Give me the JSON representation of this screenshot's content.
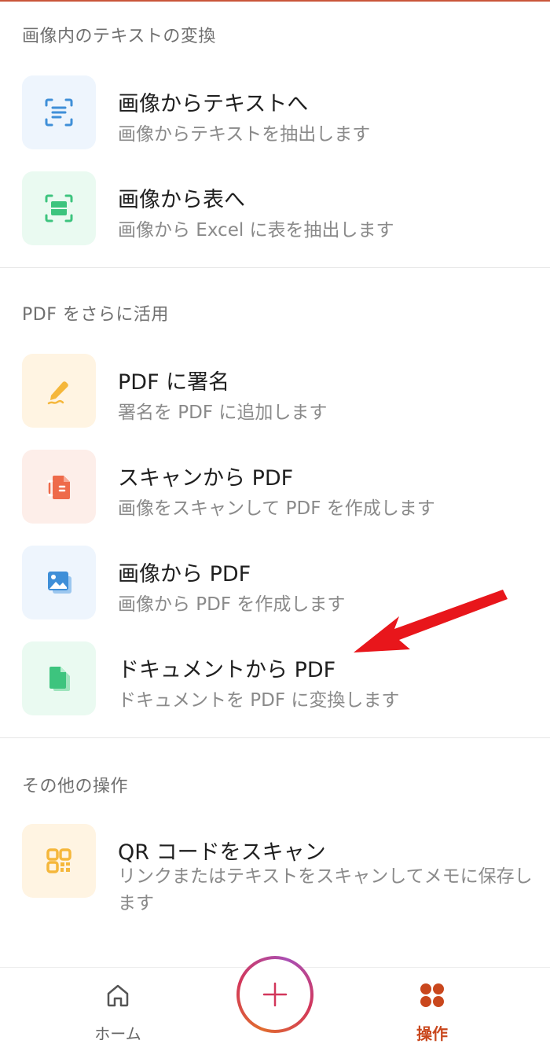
{
  "sections": {
    "image_text": {
      "header": "画像内のテキストの変換",
      "items": [
        {
          "title": "画像からテキストへ",
          "subtitle": "画像からテキストを抽出します",
          "icon": "text-scan-icon"
        },
        {
          "title": "画像から表へ",
          "subtitle": "画像から Excel に表を抽出します",
          "icon": "table-scan-icon"
        }
      ]
    },
    "pdf": {
      "header": "PDF をさらに活用",
      "items": [
        {
          "title": "PDF に署名",
          "subtitle": "署名を PDF に追加します",
          "icon": "pen-sign-icon"
        },
        {
          "title": "スキャンから PDF",
          "subtitle": "画像をスキャンして PDF を作成します",
          "icon": "scan-document-icon"
        },
        {
          "title": "画像から PDF",
          "subtitle": "画像から PDF を作成します",
          "icon": "image-icon"
        },
        {
          "title": "ドキュメントから PDF",
          "subtitle": "ドキュメントを PDF に変換します",
          "icon": "document-icon"
        }
      ]
    },
    "other": {
      "header": "その他の操作",
      "items": [
        {
          "title": "QR コードをスキャン",
          "subtitle": "リンクまたはテキストをスキャンしてメモに保存します",
          "icon": "qr-code-icon"
        }
      ]
    }
  },
  "bottom_nav": {
    "home_label": "ホーム",
    "actions_label": "操作",
    "fab_icon": "plus-icon"
  },
  "colors": {
    "accent": "#c9471d",
    "annotation_arrow": "#e8161b"
  }
}
